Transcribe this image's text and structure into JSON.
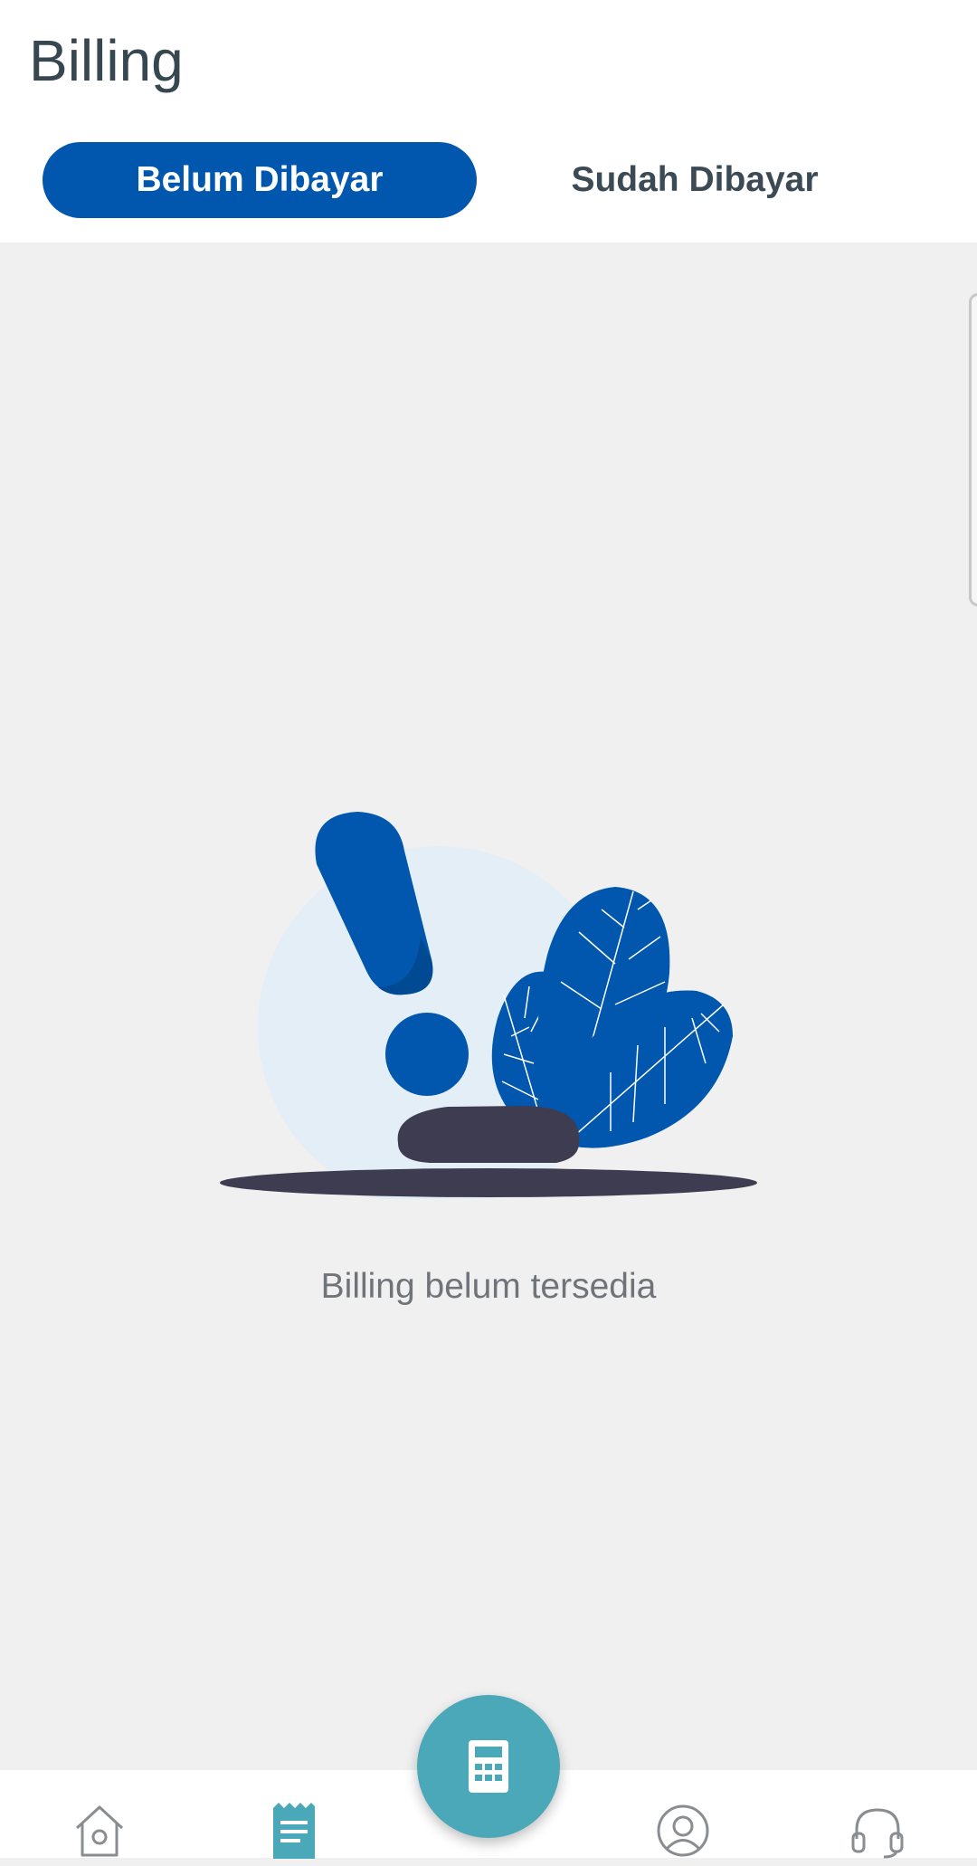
{
  "header": {
    "title": "Billing",
    "tabs": [
      {
        "label": "Belum Dibayar",
        "active": true
      },
      {
        "label": "Sudah Dibayar",
        "active": false
      }
    ]
  },
  "empty_state": {
    "message": "Billing belum tersedia",
    "illustration": "exclamation-with-leaves"
  },
  "bottom_nav": {
    "items": [
      {
        "icon": "home-icon",
        "active": false
      },
      {
        "icon": "receipt-icon",
        "active": true
      },
      {
        "icon": "calculator-icon",
        "active": false
      },
      {
        "icon": "user-icon",
        "active": false
      },
      {
        "icon": "headset-icon",
        "active": false
      }
    ]
  },
  "colors": {
    "primary": "#0057ad",
    "accent": "#4aa8b9",
    "background": "#f0f0f1",
    "title_text": "#37474f"
  }
}
